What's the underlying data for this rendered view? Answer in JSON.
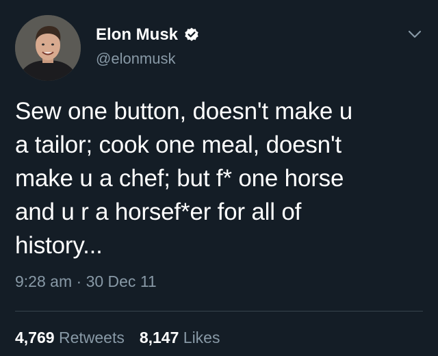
{
  "user": {
    "display_name": "Elon Musk",
    "handle": "@elonmusk",
    "verified": true
  },
  "icons": {
    "verified": "verified-badge-icon",
    "menu": "chevron-down-icon"
  },
  "tweet": {
    "lines": [
      "Sew one button, doesn't make u",
      "a tailor; cook one meal, doesn't",
      "make u a chef; but f* one horse",
      "and u r a horsef*er for all of",
      "history..."
    ],
    "time": "9:28 am",
    "separator": "·",
    "date": "30 Dec 11"
  },
  "stats": {
    "retweets_count": "4,769",
    "retweets_label": "Retweets",
    "likes_count": "8,147",
    "likes_label": "Likes"
  },
  "colors": {
    "background": "#141d26",
    "text": "#ffffff",
    "secondary_text": "#8899a6",
    "divider": "#38444d"
  }
}
